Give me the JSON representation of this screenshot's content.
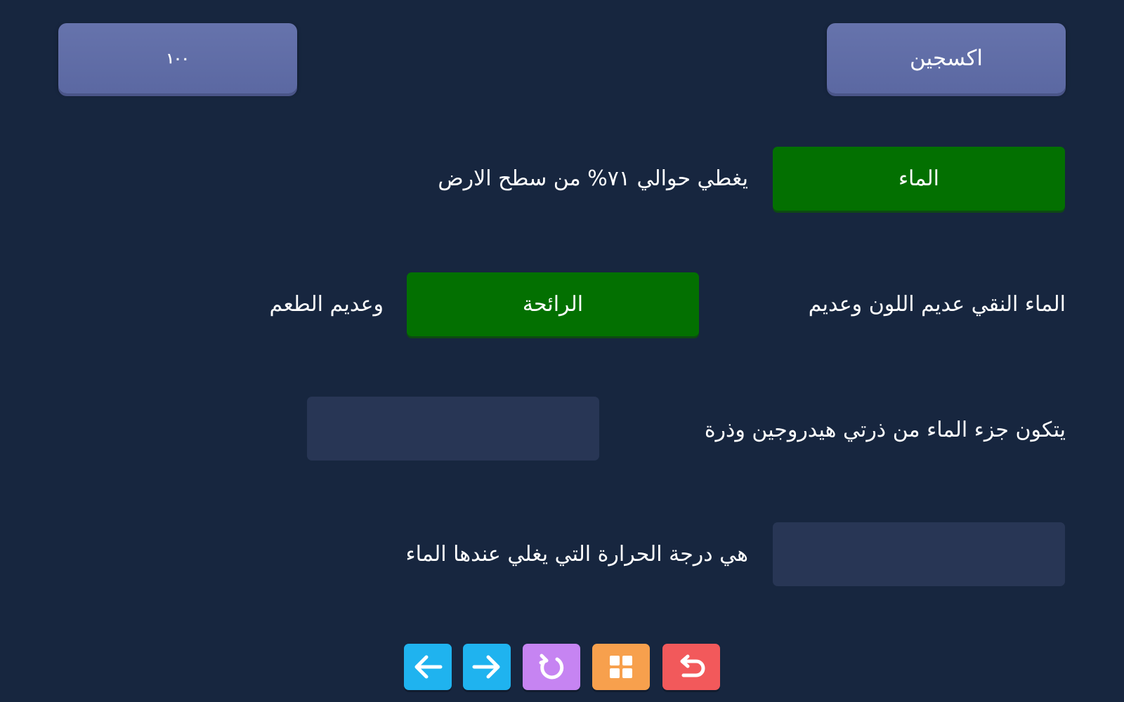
{
  "options": {
    "left_label": "١٠٠",
    "right_label": "اكسجين"
  },
  "rows": [
    {
      "text_right_of_slot": "يغطي حوالي ٧١% من سطح الارض",
      "slot_value": "الماء",
      "slot_filled": true
    },
    {
      "text_before": "الماء النقي عديم اللون وعديم",
      "slot_value": "الرائحة",
      "text_after": "وعديم الطعم",
      "slot_filled": true
    },
    {
      "text_before": "يتكون جزء الماء من ذرتي هيدروجين وذرة",
      "slot_value": "",
      "slot_filled": false
    },
    {
      "text_right_of_slot": "هي درجة الحرارة التي يغلي عندها الماء",
      "slot_value": "",
      "slot_filled": false
    }
  ],
  "toolbar": {
    "buttons": [
      {
        "icon": "arrow-left-icon",
        "color": "#1fb3ef"
      },
      {
        "icon": "arrow-right-icon",
        "color": "#1fb3ef"
      },
      {
        "icon": "reload-icon",
        "color": "#c684f2"
      },
      {
        "icon": "grid-icon",
        "color": "#f7a04d"
      },
      {
        "icon": "undo-icon",
        "color": "#f2595b"
      }
    ]
  },
  "colors": {
    "background": "#17263f",
    "option_card": "#5f6ca6",
    "filled_slot": "#037001",
    "empty_slot": "#283655"
  }
}
